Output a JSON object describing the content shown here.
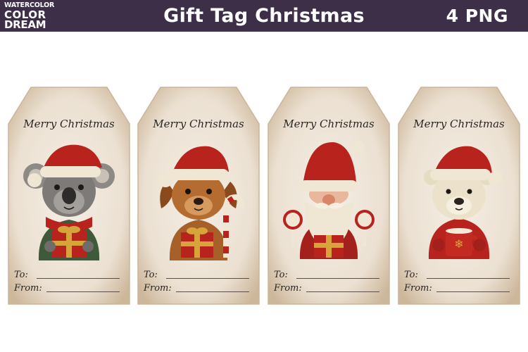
{
  "header": {
    "logo": {
      "line1": "WATERCOLOR",
      "line2": "COLOR",
      "line3": "DREAM"
    },
    "title": "Gift Tag Christmas",
    "count_label": "4 PNG"
  },
  "tags": [
    {
      "greeting": "Merry Christmas",
      "to_label": "To:",
      "from_label": "From:",
      "character": "koala"
    },
    {
      "greeting": "Merry Christmas",
      "to_label": "To:",
      "from_label": "From:",
      "character": "puppy"
    },
    {
      "greeting": "Merry Christmas",
      "to_label": "To:",
      "from_label": "From:",
      "character": "gnome"
    },
    {
      "greeting": "Merry Christmas",
      "to_label": "To:",
      "from_label": "From:",
      "character": "polar-bear"
    }
  ],
  "colors": {
    "banner": "#3d2f48",
    "tag_paper": "#efe6da",
    "tag_edge": "#d9c8b4",
    "hat_red": "#b8231e",
    "fur_white": "#efe7d4"
  }
}
